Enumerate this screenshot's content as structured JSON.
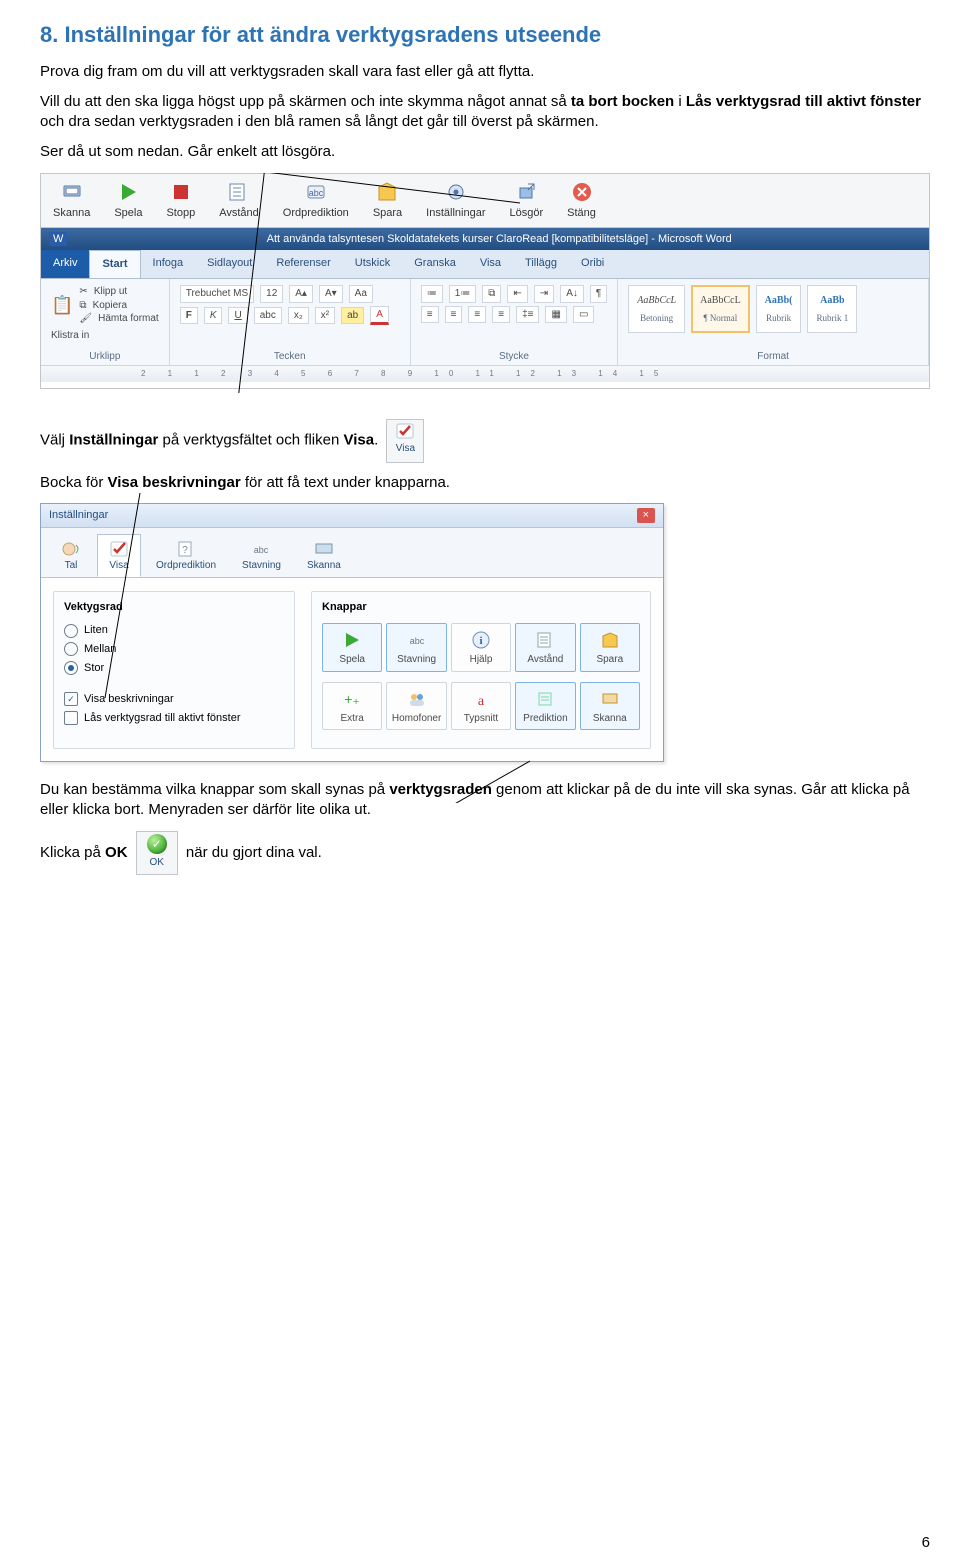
{
  "heading": "8. Inställningar för att ändra verktygsradens utseende",
  "intro": "Prova dig fram om du vill att verktygsraden skall vara fast eller gå att flytta.",
  "para2a": "Vill du att den ska ligga högst upp på skärmen och inte skymma något annat så ",
  "para2b": "ta bort bocken",
  "para2c": " i ",
  "para2d": "Lås verktygsrad till aktivt fönster",
  "para2e": " och dra sedan verktygsraden i den blå ramen så långt det går till överst på skärmen.",
  "para3": "Ser då ut som nedan. Går enkelt att lösgöra.",
  "claro": {
    "skanna": "Skanna",
    "spela": "Spela",
    "stopp": "Stopp",
    "avstand": "Avstånd",
    "ordprediktion": "Ordprediktion",
    "spara": "Spara",
    "installningar": "Inställningar",
    "losgor": "Lösgör",
    "stang": "Stäng"
  },
  "word": {
    "doc_title": "Att använda talsyntesen Skoldatatekets kurser ClaroRead [kompatibilitetsläge] - Microsoft Word",
    "tabs": {
      "arkiv": "Arkiv",
      "start": "Start",
      "infoga": "Infoga",
      "sidlayout": "Sidlayout",
      "referenser": "Referenser",
      "utskick": "Utskick",
      "granska": "Granska",
      "visa": "Visa",
      "tillagg": "Tillägg",
      "oribi": "Oribi"
    },
    "clipboard": {
      "klistra": "Klistra in",
      "klipp": "Klipp ut",
      "kopiera": "Kopiera",
      "hamta": "Hämta format",
      "title": "Urklipp"
    },
    "font": {
      "name": "Trebuchet MS",
      "size": "12",
      "title": "Tecken"
    },
    "paragraph_title": "Stycke",
    "styles": {
      "s1": "AaBbCcL",
      "l1": "Betoning",
      "s2": "AaBbCcL",
      "l2": "¶ Normal",
      "s3": "AaBb(",
      "l3": "Rubrik",
      "s4": "AaBb",
      "l4": "Rubrik 1",
      "title": "Format"
    },
    "ruler": "2 1 1 2 3 4 5 6 7 8 9 10 11 12 13 14 15"
  },
  "visa_badge_label": "Visa",
  "mid1a": "Välj ",
  "mid1b": "Inställningar",
  "mid1c": " på verktygsfältet och fliken ",
  "mid1d": "Visa",
  "mid1e": ".",
  "mid2a": "Bocka för ",
  "mid2b": "Visa beskrivningar",
  "mid2c": " för att få text under knapparna.",
  "dlg": {
    "title": "Inställningar",
    "close_x": "×",
    "tabs": {
      "tal": "Tal",
      "visa": "Visa",
      "ordprediktion": "Ordprediktion",
      "stavning": "Stavning",
      "skanna": "Skanna"
    },
    "left": {
      "heading": "Vektygsrad",
      "liten": "Liten",
      "mellan": "Mellan",
      "stor": "Stor",
      "visa_besk": "Visa beskrivningar",
      "las": "Lås verktygsrad till aktivt fönster"
    },
    "right": {
      "heading": "Knappar",
      "row1": {
        "spela": "Spela",
        "stavning": "Stavning",
        "hjalp": "Hjälp",
        "avstand": "Avstånd",
        "spara": "Spara"
      },
      "row2": {
        "extra": "Extra",
        "homofoner": "Homofoner",
        "typsnitt": "Typsnitt",
        "prediktion": "Prediktion",
        "skanna": "Skanna"
      }
    }
  },
  "end1a": "Du kan bestämma vilka knappar som skall synas på ",
  "end1b": "verktygsraden",
  "end1c": " genom att klickar på de du inte vill ska synas. Går att klicka på eller klicka bort. Menyraden ser därför lite olika ut.",
  "end2a": "Klicka på ",
  "end2b": "OK",
  "end2c": " när du gjort dina val.",
  "ok_label": "OK",
  "page_number": "6"
}
